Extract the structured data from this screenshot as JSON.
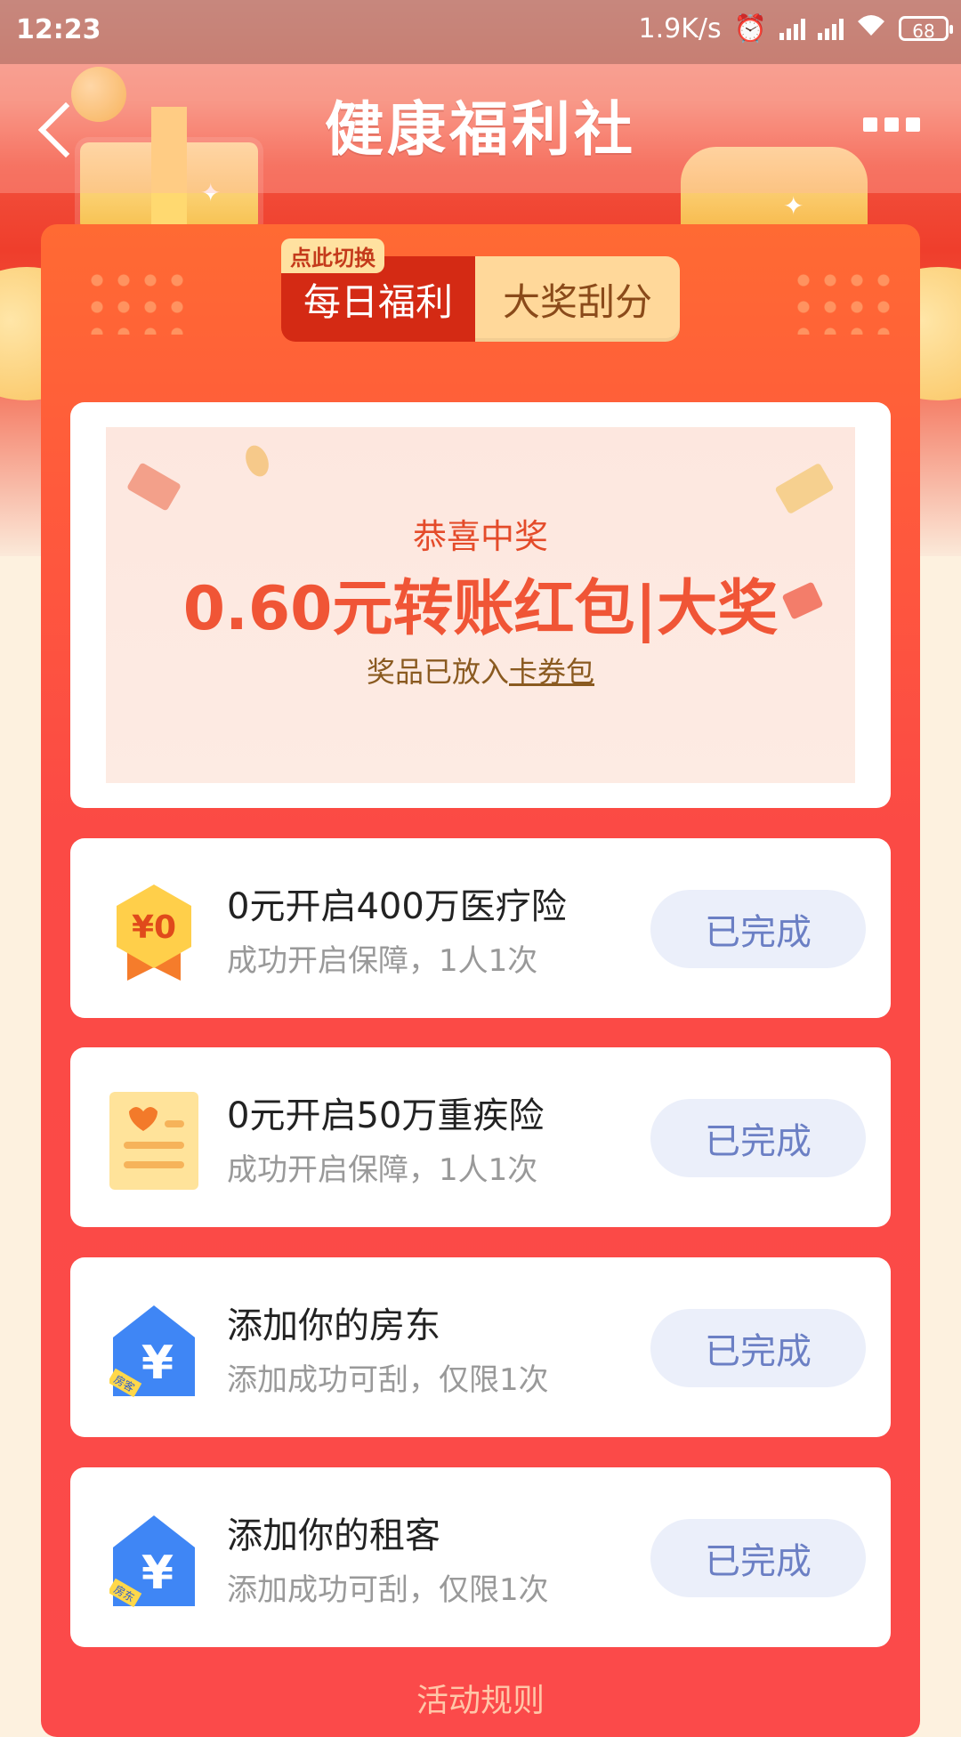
{
  "status_bar": {
    "time": "12:23",
    "network_speed": "1.9K/s",
    "battery": "68",
    "icons": [
      "alarm-icon",
      "signal-icon",
      "signal-icon",
      "wifi-icon",
      "battery-icon"
    ]
  },
  "nav": {
    "title": "健康福利社",
    "back_icon": "chevron-left-icon",
    "more_icon": "more-icon"
  },
  "toggle": {
    "tip": "点此切换",
    "daily_label": "每日福利",
    "scratch_label": "大奖刮分"
  },
  "prize": {
    "title": "恭喜中奖",
    "amount": "0.60元转账红包|大奖",
    "note_prefix": "奖品已放入",
    "note_link": "卡券包"
  },
  "tasks": [
    {
      "name": "0元开启400万医疗险",
      "desc": "成功开启保障，1人1次",
      "button": "已完成",
      "icon": "badge-zero-icon",
      "icon_text": "¥0"
    },
    {
      "name": "0元开启50万重疾险",
      "desc": "成功开启保障，1人1次",
      "button": "已完成",
      "icon": "heart-document-icon"
    },
    {
      "name": "添加你的房东",
      "desc": "添加成功可刮，仅限1次",
      "button": "已完成",
      "icon": "house-yuan-icon",
      "icon_tag": "房客"
    },
    {
      "name": "添加你的租客",
      "desc": "添加成功可刮，仅限1次",
      "button": "已完成",
      "icon": "house-yuan-icon",
      "icon_tag": "房东"
    }
  ],
  "footer": {
    "rules_label": "活动规则"
  },
  "colors": {
    "panel_red": "#fb4a45",
    "toggle_active": "#d42a14",
    "toggle_inactive": "#ffd89a",
    "done_button_bg": "#ebeffa",
    "done_button_text": "#6b7fc4",
    "prize_text": "#f05536"
  }
}
